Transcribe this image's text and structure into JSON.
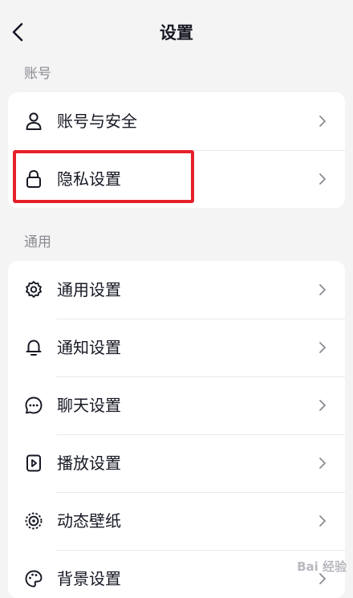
{
  "header": {
    "title": "设置"
  },
  "sections": {
    "account": {
      "label": "账号",
      "items": [
        {
          "label": "账号与安全",
          "icon": "person-icon"
        },
        {
          "label": "隐私设置",
          "icon": "lock-icon"
        }
      ]
    },
    "general": {
      "label": "通用",
      "items": [
        {
          "label": "通用设置",
          "icon": "gear-icon"
        },
        {
          "label": "通知设置",
          "icon": "bell-icon"
        },
        {
          "label": "聊天设置",
          "icon": "chat-icon"
        },
        {
          "label": "播放设置",
          "icon": "play-icon"
        },
        {
          "label": "动态壁纸",
          "icon": "wallpaper-icon"
        },
        {
          "label": "背景设置",
          "icon": "palette-icon"
        }
      ]
    }
  },
  "colors": {
    "highlight": "#e5202a",
    "background": "#f4f4f5"
  },
  "watermark": "Bai 经验"
}
